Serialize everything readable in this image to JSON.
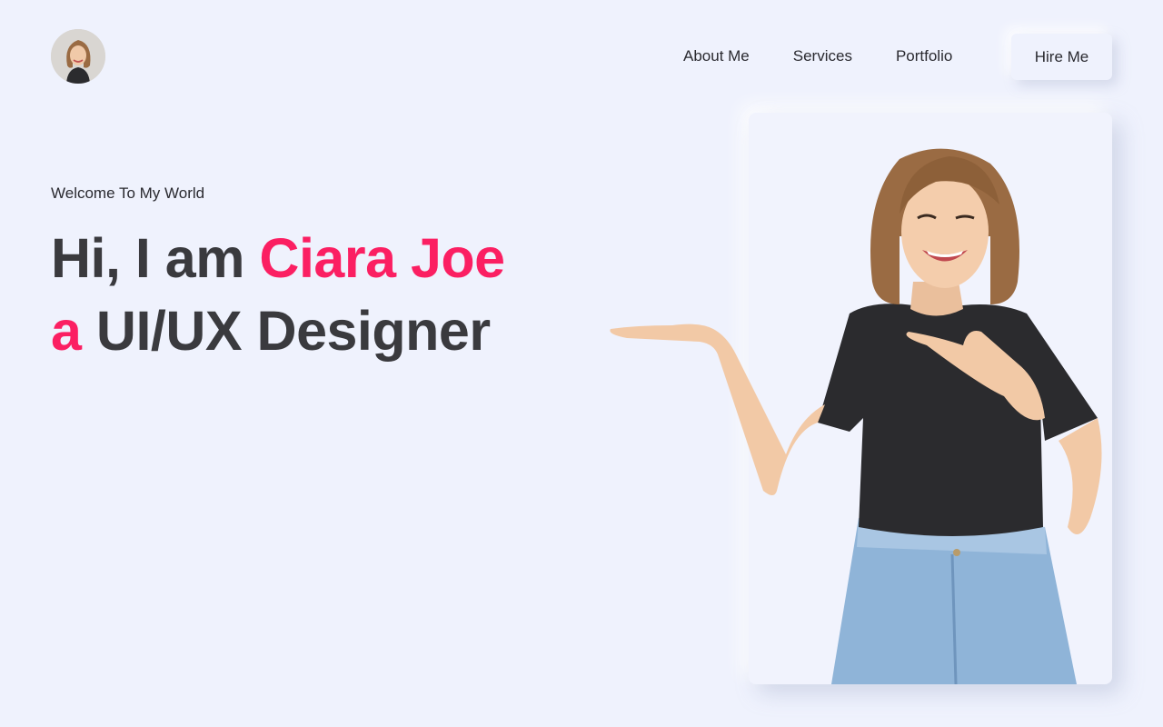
{
  "header": {
    "avatar_alt": "Ciara Joe avatar",
    "nav": [
      "About Me",
      "Services",
      "Portfolio"
    ],
    "hire_label": "Hire Me"
  },
  "hero": {
    "welcome": "Welcome To My World",
    "line1_prefix": "Hi, I am ",
    "name": "Ciara Joe",
    "line2_accent": "a",
    "line2_rest": " UI/UX Designer"
  },
  "colors": {
    "background": "#eff2fd",
    "accent": "#fb1f62",
    "heading": "#3a3a3e"
  }
}
